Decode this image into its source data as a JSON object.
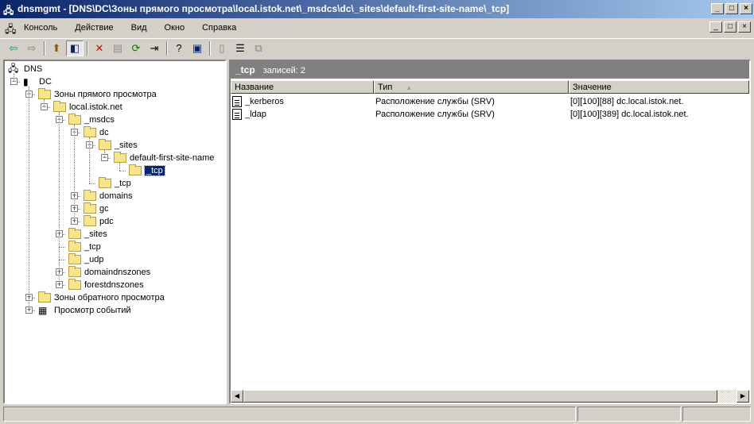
{
  "window": {
    "title": "dnsmgmt - [DNS\\DC\\Зоны прямого просмотра\\local.istok.net\\_msdcs\\dc\\_sites\\default-first-site-name\\_tcp]",
    "minimize": "_",
    "maximize": "□",
    "close": "×"
  },
  "menu": [
    {
      "label": "Консоль"
    },
    {
      "label": "Действие"
    },
    {
      "label": "Вид"
    },
    {
      "label": "Окно"
    },
    {
      "label": "Справка"
    }
  ],
  "toolbar": [
    {
      "icon": "back-icon",
      "g": "⇦",
      "color": "#0a8a8a"
    },
    {
      "icon": "forward-icon",
      "g": "⇨",
      "color": "#808080"
    },
    {
      "sep": true
    },
    {
      "icon": "up-folder-icon",
      "g": "⬆",
      "color": "#806000"
    },
    {
      "icon": "show-hide-tree-icon",
      "g": "◧",
      "color": "#0a246a",
      "on": true
    },
    {
      "sep": true
    },
    {
      "icon": "delete-icon",
      "g": "✕",
      "color": "#e00000"
    },
    {
      "icon": "properties-icon",
      "g": "▤",
      "color": "#909090"
    },
    {
      "icon": "refresh-icon",
      "g": "⟳",
      "color": "#008000"
    },
    {
      "icon": "export-list-icon",
      "g": "⇥",
      "color": "#000"
    },
    {
      "sep": true
    },
    {
      "icon": "help-icon",
      "g": "?",
      "color": "#000"
    },
    {
      "icon": "show-action-pane-icon",
      "g": "▣",
      "color": "#0a246a"
    },
    {
      "sep": true
    },
    {
      "icon": "server-icon",
      "g": "▯",
      "color": "#808080"
    },
    {
      "icon": "record-icon",
      "g": "☰",
      "color": "#000"
    },
    {
      "icon": "copy-icon",
      "g": "⧉",
      "color": "#808080"
    }
  ],
  "tree": [
    {
      "label": "DNS",
      "level": 0,
      "exp": "",
      "icon": "dns-icon"
    },
    {
      "label": "DC",
      "level": 1,
      "exp": "-",
      "icon": "server-icon"
    },
    {
      "label": "Зоны прямого просмотра",
      "level": 2,
      "exp": "-",
      "icon": "folder-icon"
    },
    {
      "label": "local.istok.net",
      "level": 3,
      "exp": "-",
      "icon": "zone-icon"
    },
    {
      "label": "_msdcs",
      "level": 4,
      "exp": "-",
      "icon": "folder-icon"
    },
    {
      "label": "dc",
      "level": 5,
      "exp": "-",
      "icon": "folder-icon"
    },
    {
      "label": "_sites",
      "level": 6,
      "exp": "-",
      "icon": "folder-icon"
    },
    {
      "label": "default-first-site-name",
      "level": 7,
      "exp": "-",
      "icon": "folder-icon"
    },
    {
      "label": "_tcp",
      "level": 8,
      "exp": "",
      "icon": "folder-icon",
      "selected": true
    },
    {
      "label": "_tcp",
      "level": 6,
      "exp": "",
      "icon": "folder-icon"
    },
    {
      "label": "domains",
      "level": 5,
      "exp": "+",
      "icon": "folder-icon"
    },
    {
      "label": "gc",
      "level": 5,
      "exp": "+",
      "icon": "folder-icon"
    },
    {
      "label": "pdc",
      "level": 5,
      "exp": "+",
      "icon": "folder-icon"
    },
    {
      "label": "_sites",
      "level": 4,
      "exp": "+",
      "icon": "folder-icon"
    },
    {
      "label": "_tcp",
      "level": 4,
      "exp": "",
      "icon": "folder-icon"
    },
    {
      "label": "_udp",
      "level": 4,
      "exp": "",
      "icon": "folder-icon"
    },
    {
      "label": "domaindnszones",
      "level": 4,
      "exp": "+",
      "icon": "folder-icon"
    },
    {
      "label": "forestdnszones",
      "level": 4,
      "exp": "+",
      "icon": "folder-icon"
    },
    {
      "label": "Зоны обратного просмотра",
      "level": 2,
      "exp": "+",
      "icon": "folder-icon"
    },
    {
      "label": "Просмотр событий",
      "level": 2,
      "exp": "+",
      "icon": "event-viewer-icon"
    }
  ],
  "details": {
    "title": "_tcp",
    "count": "записей: 2",
    "columns": [
      {
        "label": "Название"
      },
      {
        "label": "Тип",
        "sort": "▲"
      },
      {
        "label": "Значение"
      }
    ],
    "rows": [
      {
        "name": "_kerberos",
        "type": "Расположение службы (SRV)",
        "value": "[0][100][88] dc.local.istok.net."
      },
      {
        "name": "_ldap",
        "type": "Расположение службы (SRV)",
        "value": "[0][100][389] dc.local.istok.net."
      }
    ]
  }
}
